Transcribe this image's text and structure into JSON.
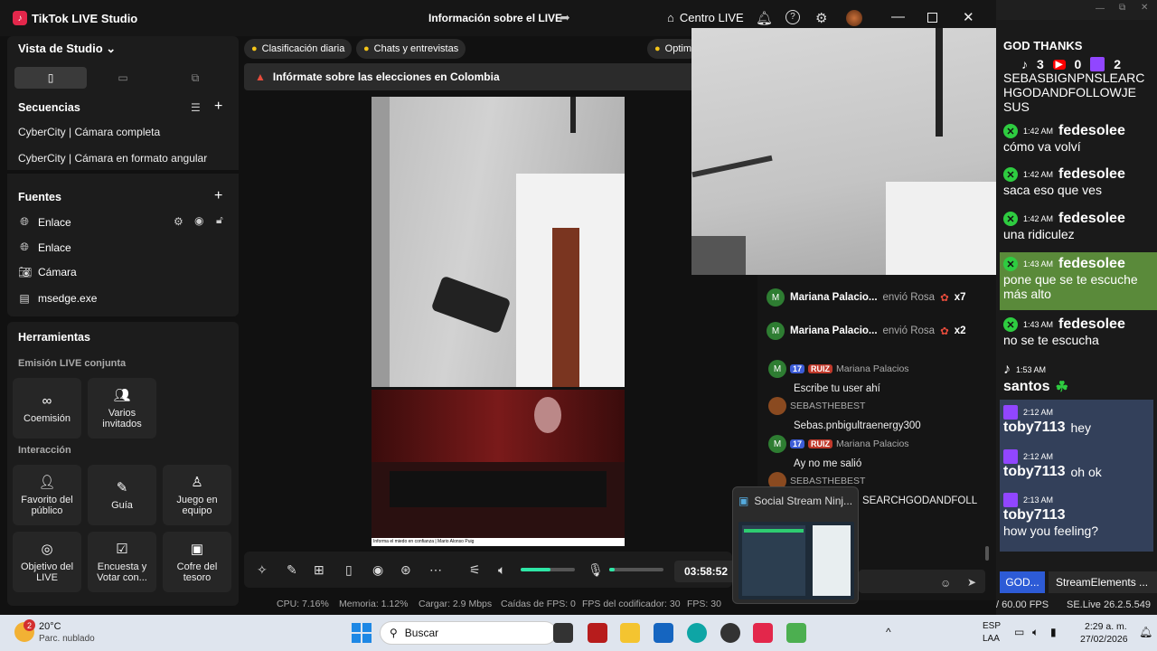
{
  "titlebar": {
    "app_title": "TikTok LIVE Studio",
    "center_title": "Información sobre el LIVE",
    "centro_label": "Centro LIVE"
  },
  "studio": {
    "view_label": "Vista de Studio",
    "sequences_title": "Secuencias",
    "sequences": [
      "CyberCity | Cámara completa",
      "CyberCity | Cámara en formato angular"
    ],
    "sources_title": "Fuentes",
    "sources": [
      {
        "label": "Enlace",
        "icon": "globe-icon"
      },
      {
        "label": "Enlace",
        "icon": "globe-icon"
      },
      {
        "label": "Cámara",
        "icon": "camera-icon"
      },
      {
        "label": "msedge.exe",
        "icon": "window-icon"
      }
    ]
  },
  "tools": {
    "title": "Herramientas",
    "joint_title": "Emisión LIVE conjunta",
    "joint": [
      "Coemisión",
      "Varios invitados"
    ],
    "interaction_title": "Interacción",
    "interaction": [
      "Favorito del público",
      "Guía",
      "Juego en equipo",
      "Objetivo del LIVE",
      "Encuesta y Votar con...",
      "Cofre del tesoro"
    ]
  },
  "main": {
    "pills": [
      "Clasificación diaria",
      "Chats y entrevistas",
      "Optim"
    ],
    "alert": "Infórmate sobre las elecciones en Colombia",
    "caption": "Informa el miedo en confianza | Mario Alonso Puig",
    "timer": "03:58:52",
    "volume_level": 0.55,
    "mic_level": 0.1,
    "stats": {
      "cpu": "CPU: 7.16%",
      "memoria": "Memoria: 1.12%",
      "cargar": "Cargar: 2.9 Mbps",
      "caidas": "Caídas de FPS: 0",
      "fps_cod": "FPS del codificador: 30",
      "fps": "FPS: 30"
    }
  },
  "gifts": [
    {
      "name": "Mariana Palacio...",
      "action": "envió Rosa",
      "count": "x7"
    },
    {
      "name": "Mariana Palacio...",
      "action": "envió Rosa",
      "count": "x2"
    }
  ],
  "chat": [
    {
      "level": "17",
      "tag": "RUIZ",
      "name": "Mariana Palacios",
      "msg": "Escribe tu user ahí"
    },
    {
      "level": "",
      "tag": "",
      "name": "SEBASTHEBEST",
      "msg": "Sebas.pnbigultraenergy300"
    },
    {
      "level": "17",
      "tag": "RUIZ",
      "name": "Mariana Palacios",
      "msg": "Ay no me salió"
    },
    {
      "level": "",
      "tag": "",
      "name": "SEBASTHEBEST",
      "msg": "SEARCHGODANDFOLL"
    }
  ],
  "popup": {
    "title": "Social Stream Ninj..."
  },
  "stream": {
    "header": "GOD THANKS",
    "counts": {
      "tiktok": "3",
      "youtube": "0",
      "twitch": "2"
    },
    "top_text": "SEBASBIGNPNSLEARC HGODANDFOLLOWJE SUS",
    "messages": [
      {
        "time": "1:42 AM",
        "user": "fedesolee",
        "text": "cómo va volví",
        "platform": "kick"
      },
      {
        "time": "1:42 AM",
        "user": "fedesolee",
        "text": "saca eso que ves",
        "platform": "kick"
      },
      {
        "time": "1:42 AM",
        "user": "fedesolee",
        "text": "una ridiculez",
        "platform": "kick"
      },
      {
        "time": "1:43 AM",
        "user": "fedesolee",
        "text": "pone que se te escuche más alto",
        "platform": "kick"
      },
      {
        "time": "1:43 AM",
        "user": "fedesolee",
        "text": "no se te escucha",
        "platform": "kick"
      },
      {
        "time": "1:53 AM",
        "user": "santos",
        "text": "",
        "platform": "tiktok"
      },
      {
        "time": "2:12 AM",
        "user": "toby7113",
        "text": "hey",
        "platform": "twitch"
      },
      {
        "time": "2:12 AM",
        "user": "toby7113",
        "text": "oh ok",
        "platform": "twitch"
      },
      {
        "time": "2:13 AM",
        "user": "toby7113",
        "text": "how you feeling?",
        "platform": "twitch"
      }
    ],
    "tab_a": "GOD...",
    "tab_b": "StreamElements ...",
    "fps": "/ 60.00 FPS",
    "version": "SE.Live 26.2.5.549"
  },
  "taskbar": {
    "weather_temp": "20°C",
    "weather_desc": "Parc. nublado",
    "weather_badge": "2",
    "search": "Buscar",
    "lang1": "ESP",
    "lang2": "LAA",
    "time": "2:29 a. m.",
    "date": "27/02/2026"
  }
}
